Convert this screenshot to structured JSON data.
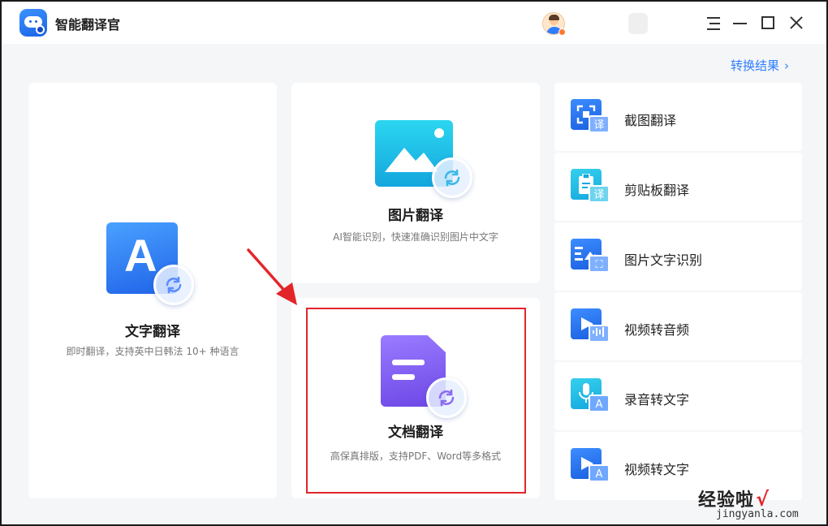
{
  "app": {
    "title": "智能翻译官"
  },
  "header": {
    "results_link": "转换结果",
    "results_chevron": "›"
  },
  "cards": {
    "text": {
      "title": "文字翻译",
      "desc": "即时翻译，支持英中日韩法 10+ 种语言",
      "letter": "A"
    },
    "image": {
      "title": "图片翻译",
      "desc": "AI智能识别，快速准确识别图片中文字"
    },
    "doc": {
      "title": "文档翻译",
      "desc": "高保真排版，支持PDF、Word等多格式"
    }
  },
  "tools": [
    {
      "label": "截图翻译",
      "icon": "screenshot-translate-icon",
      "badge": "译"
    },
    {
      "label": "剪贴板翻译",
      "icon": "clipboard-translate-icon",
      "badge": "译"
    },
    {
      "label": "图片文字识别",
      "icon": "image-ocr-icon"
    },
    {
      "label": "视频转音频",
      "icon": "video-to-audio-icon"
    },
    {
      "label": "录音转文字",
      "icon": "recording-to-text-icon",
      "badge": "A"
    },
    {
      "label": "视频转文字",
      "icon": "video-to-text-icon",
      "badge": "A"
    }
  ],
  "watermark": {
    "text": "经验啦",
    "check": "√",
    "url": "jingyanla.com"
  },
  "colors": {
    "accent": "#2f7dff",
    "highlight": "#e3252a",
    "background": "#f5f6f8"
  }
}
